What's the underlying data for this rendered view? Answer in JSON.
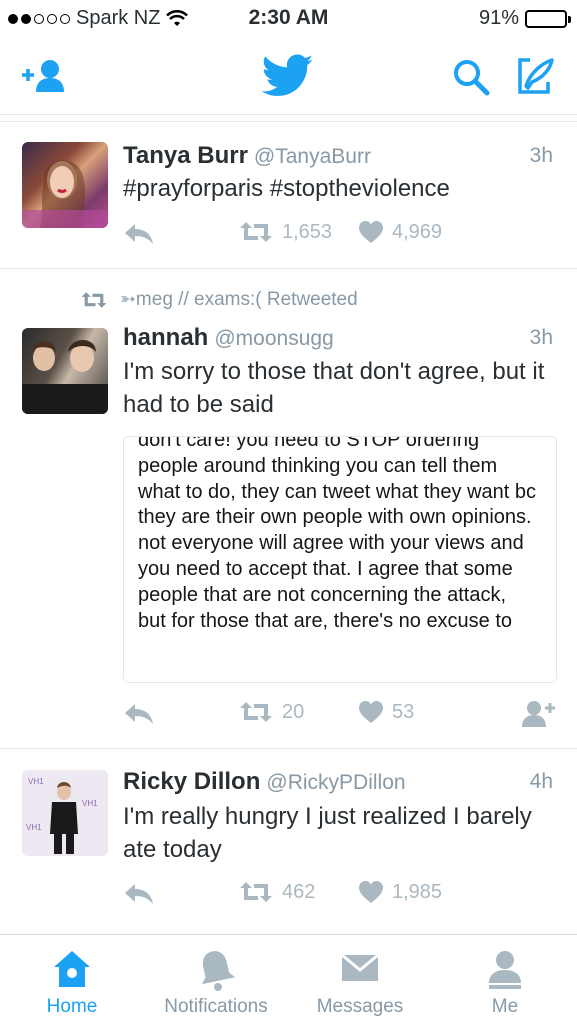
{
  "status_bar": {
    "carrier": "Spark NZ",
    "time": "2:30 AM",
    "battery": "91%",
    "battery_level": 0.91
  },
  "colors": {
    "accent": "#1da1f2",
    "muted": "#8899a6",
    "icon_gray": "#aab8c2"
  },
  "top_bar": {
    "left_icon": "add-user-icon",
    "center_icon": "twitter-bird-icon",
    "right_icons": [
      "search-icon",
      "compose-icon"
    ]
  },
  "tweets": [
    {
      "name": "Tanya Burr",
      "handle": "@TanyaBurr",
      "time": "3h",
      "text": "#prayforparis #stoptheviolence",
      "retweets": "1,653",
      "likes": "4,969"
    },
    {
      "retweeted_by": "➳meg // exams:( Retweeted",
      "name": "hannah",
      "handle": "@moonsugg",
      "time": "3h",
      "text": "I'm sorry to those that don't agree, but it had to be said",
      "image_text": "don't care! you need to STOP ordering people around thinking you can tell them what to do, they can tweet what they want bc they are their own people with own opinions. not everyone will agree with your views and you need to accept that. I agree that some people that are not concerning the attack, but for those that are, there's no excuse to",
      "retweets": "20",
      "likes": "53"
    },
    {
      "name": "Ricky Dillon",
      "handle": "@RickyPDillon",
      "time": "4h",
      "text": "I'm really hungry I just realized I barely ate today",
      "retweets": "462",
      "likes": "1,985"
    }
  ],
  "tab_bar": [
    {
      "label": "Home",
      "icon": "home-icon",
      "active": true
    },
    {
      "label": "Notifications",
      "icon": "bell-icon"
    },
    {
      "label": "Messages",
      "icon": "envelope-icon"
    },
    {
      "label": "Me",
      "icon": "person-icon"
    }
  ]
}
